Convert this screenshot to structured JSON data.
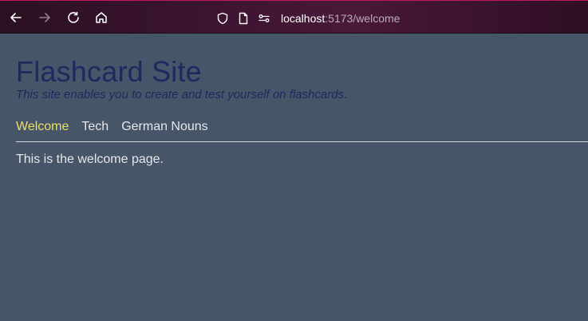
{
  "browser": {
    "url_host": "localhost",
    "url_path": ":5173/welcome",
    "icons": [
      "back-arrow-icon",
      "forward-arrow-icon",
      "reload-icon",
      "home-icon",
      "shield-icon",
      "page-icon",
      "site-permissions-icon"
    ]
  },
  "site": {
    "title": "Flashcard Site",
    "subtitle": "This site enables you to create and test yourself on flashcards.",
    "nav": [
      {
        "label": "Welcome",
        "active": true
      },
      {
        "label": "Tech",
        "active": false
      },
      {
        "label": "German Nouns",
        "active": false
      }
    ],
    "content": "This is the welcome page."
  },
  "colors": {
    "page_bg": "#465568",
    "title": "#1d2a5e",
    "nav_active": "#e8e06a",
    "nav_inactive": "#e5e7eb"
  }
}
